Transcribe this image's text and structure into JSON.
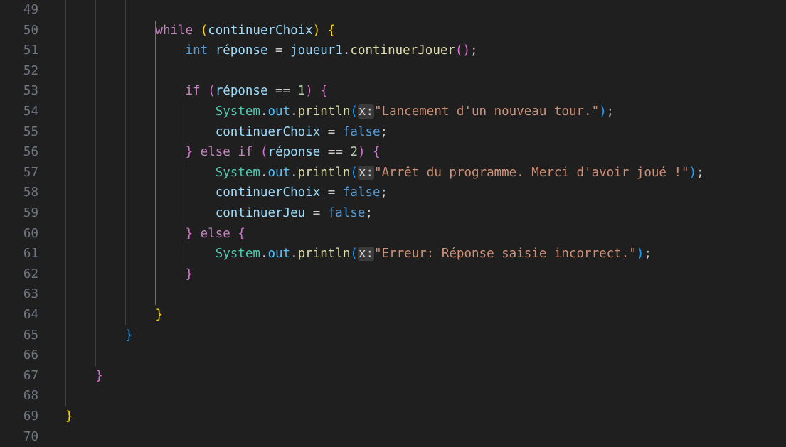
{
  "editor": {
    "language": "java",
    "colors": {
      "background": "#1f1f1f",
      "line_number": "#6e7681",
      "keyword": "#c586c0",
      "type": "#4ec9b0",
      "variable": "#9cdcfe",
      "constant": "#4fc1ff",
      "function": "#dcdcaa",
      "number": "#b5cea8",
      "string": "#ce9178",
      "boolean": "#569cd6",
      "bracket_level_1": "#ffd700",
      "bracket_level_2": "#da70d6",
      "bracket_level_3": "#179fff",
      "inlay_hint_background": "#3a3a3a"
    },
    "lines": [
      {
        "number": "49",
        "tokens": []
      },
      {
        "number": "50",
        "tokens": [
          {
            "text": "            ",
            "kind": "plain"
          },
          {
            "text": "while",
            "kind": "kw"
          },
          {
            "text": " ",
            "kind": "plain"
          },
          {
            "text": "(",
            "kind": "b1"
          },
          {
            "text": "continuerChoix",
            "kind": "var"
          },
          {
            "text": ")",
            "kind": "b1"
          },
          {
            "text": " ",
            "kind": "plain"
          },
          {
            "text": "{",
            "kind": "b1"
          }
        ]
      },
      {
        "number": "51",
        "tokens": [
          {
            "text": "                ",
            "kind": "plain"
          },
          {
            "text": "int",
            "kind": "decl"
          },
          {
            "text": " ",
            "kind": "plain"
          },
          {
            "text": "réponse",
            "kind": "var"
          },
          {
            "text": " = ",
            "kind": "plain"
          },
          {
            "text": "joueur1",
            "kind": "var"
          },
          {
            "text": ".",
            "kind": "plain"
          },
          {
            "text": "continuerJouer",
            "kind": "fn"
          },
          {
            "text": "()",
            "kind": "b2"
          },
          {
            "text": ";",
            "kind": "plain"
          }
        ]
      },
      {
        "number": "52",
        "tokens": []
      },
      {
        "number": "53",
        "tokens": [
          {
            "text": "                ",
            "kind": "plain"
          },
          {
            "text": "if",
            "kind": "kw"
          },
          {
            "text": " ",
            "kind": "plain"
          },
          {
            "text": "(",
            "kind": "b2"
          },
          {
            "text": "réponse",
            "kind": "var"
          },
          {
            "text": " == ",
            "kind": "plain"
          },
          {
            "text": "1",
            "kind": "num"
          },
          {
            "text": ")",
            "kind": "b2"
          },
          {
            "text": " ",
            "kind": "plain"
          },
          {
            "text": "{",
            "kind": "b2"
          }
        ]
      },
      {
        "number": "54",
        "tokens": [
          {
            "text": "                    ",
            "kind": "plain"
          },
          {
            "text": "System",
            "kind": "type"
          },
          {
            "text": ".",
            "kind": "plain"
          },
          {
            "text": "out",
            "kind": "const"
          },
          {
            "text": ".",
            "kind": "plain"
          },
          {
            "text": "println",
            "kind": "fn"
          },
          {
            "text": "(",
            "kind": "b3"
          },
          {
            "text": "x:",
            "kind": "hint"
          },
          {
            "text": "\"Lancement d'un nouveau tour.\"",
            "kind": "str"
          },
          {
            "text": ")",
            "kind": "b3"
          },
          {
            "text": ";",
            "kind": "plain"
          }
        ]
      },
      {
        "number": "55",
        "tokens": [
          {
            "text": "                    ",
            "kind": "plain"
          },
          {
            "text": "continuerChoix",
            "kind": "var"
          },
          {
            "text": " = ",
            "kind": "plain"
          },
          {
            "text": "false",
            "kind": "bool"
          },
          {
            "text": ";",
            "kind": "plain"
          }
        ]
      },
      {
        "number": "56",
        "tokens": [
          {
            "text": "                ",
            "kind": "plain"
          },
          {
            "text": "}",
            "kind": "b2"
          },
          {
            "text": " ",
            "kind": "plain"
          },
          {
            "text": "else",
            "kind": "kw"
          },
          {
            "text": " ",
            "kind": "plain"
          },
          {
            "text": "if",
            "kind": "kw"
          },
          {
            "text": " ",
            "kind": "plain"
          },
          {
            "text": "(",
            "kind": "b2"
          },
          {
            "text": "réponse",
            "kind": "var"
          },
          {
            "text": " == ",
            "kind": "plain"
          },
          {
            "text": "2",
            "kind": "num"
          },
          {
            "text": ")",
            "kind": "b2"
          },
          {
            "text": " ",
            "kind": "plain"
          },
          {
            "text": "{",
            "kind": "b2"
          }
        ]
      },
      {
        "number": "57",
        "tokens": [
          {
            "text": "                    ",
            "kind": "plain"
          },
          {
            "text": "System",
            "kind": "type"
          },
          {
            "text": ".",
            "kind": "plain"
          },
          {
            "text": "out",
            "kind": "const"
          },
          {
            "text": ".",
            "kind": "plain"
          },
          {
            "text": "println",
            "kind": "fn"
          },
          {
            "text": "(",
            "kind": "b3"
          },
          {
            "text": "x:",
            "kind": "hint"
          },
          {
            "text": "\"Arrêt du programme. Merci d'avoir joué !\"",
            "kind": "str"
          },
          {
            "text": ")",
            "kind": "b3"
          },
          {
            "text": ";",
            "kind": "plain"
          }
        ]
      },
      {
        "number": "58",
        "tokens": [
          {
            "text": "                    ",
            "kind": "plain"
          },
          {
            "text": "continuerChoix",
            "kind": "var"
          },
          {
            "text": " = ",
            "kind": "plain"
          },
          {
            "text": "false",
            "kind": "bool"
          },
          {
            "text": ";",
            "kind": "plain"
          }
        ]
      },
      {
        "number": "59",
        "tokens": [
          {
            "text": "                    ",
            "kind": "plain"
          },
          {
            "text": "continuerJeu",
            "kind": "var"
          },
          {
            "text": " = ",
            "kind": "plain"
          },
          {
            "text": "false",
            "kind": "bool"
          },
          {
            "text": ";",
            "kind": "plain"
          }
        ]
      },
      {
        "number": "60",
        "tokens": [
          {
            "text": "                ",
            "kind": "plain"
          },
          {
            "text": "}",
            "kind": "b2"
          },
          {
            "text": " ",
            "kind": "plain"
          },
          {
            "text": "else",
            "kind": "kw"
          },
          {
            "text": " ",
            "kind": "plain"
          },
          {
            "text": "{",
            "kind": "b2"
          }
        ]
      },
      {
        "number": "61",
        "tokens": [
          {
            "text": "                    ",
            "kind": "plain"
          },
          {
            "text": "System",
            "kind": "type"
          },
          {
            "text": ".",
            "kind": "plain"
          },
          {
            "text": "out",
            "kind": "const"
          },
          {
            "text": ".",
            "kind": "plain"
          },
          {
            "text": "println",
            "kind": "fn"
          },
          {
            "text": "(",
            "kind": "b3"
          },
          {
            "text": "x:",
            "kind": "hint"
          },
          {
            "text": "\"Erreur: Réponse saisie incorrect.\"",
            "kind": "str"
          },
          {
            "text": ")",
            "kind": "b3"
          },
          {
            "text": ";",
            "kind": "plain"
          }
        ]
      },
      {
        "number": "62",
        "tokens": [
          {
            "text": "                ",
            "kind": "plain"
          },
          {
            "text": "}",
            "kind": "b2"
          }
        ]
      },
      {
        "number": "63",
        "tokens": []
      },
      {
        "number": "64",
        "tokens": [
          {
            "text": "            ",
            "kind": "plain"
          },
          {
            "text": "}",
            "kind": "b1"
          }
        ]
      },
      {
        "number": "65",
        "tokens": [
          {
            "text": "        ",
            "kind": "plain"
          },
          {
            "text": "}",
            "kind": "b3"
          }
        ]
      },
      {
        "number": "66",
        "tokens": []
      },
      {
        "number": "67",
        "tokens": [
          {
            "text": "    ",
            "kind": "plain"
          },
          {
            "text": "}",
            "kind": "b2"
          }
        ]
      },
      {
        "number": "68",
        "tokens": []
      },
      {
        "number": "69",
        "tokens": [
          {
            "text": "}",
            "kind": "b1"
          }
        ]
      },
      {
        "number": "70",
        "tokens": []
      }
    ]
  }
}
